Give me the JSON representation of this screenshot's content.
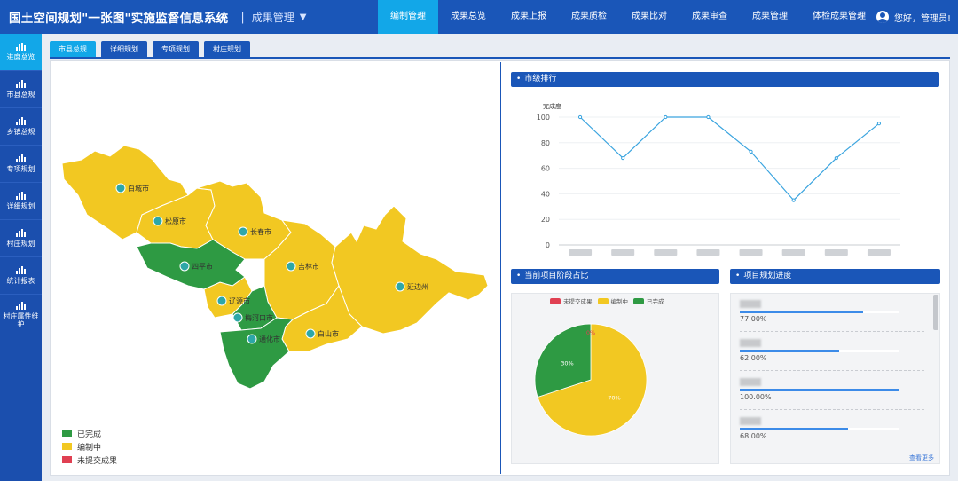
{
  "header": {
    "title": "国土空间规划\"一张图\"实施监督信息系统",
    "module_sep": "|",
    "module": "成果管理",
    "nav": [
      "编制管理",
      "成果总览",
      "成果上报",
      "成果质检",
      "成果比对",
      "成果审查",
      "成果管理",
      "体检成果管理"
    ],
    "active_nav": 0,
    "user": "您好，管理员!"
  },
  "sidebar": {
    "items": [
      "进度总览",
      "市县总规",
      "乡镇总规",
      "专项规划",
      "详细规划",
      "村庄规划",
      "统计报表",
      "村庄属性维护"
    ],
    "active": 0
  },
  "tabs": [
    "市县总规",
    "详细规划",
    "专项规划",
    "村庄规划"
  ],
  "map": {
    "cities": [
      "白城市",
      "松原市",
      "长春市",
      "四平市",
      "吉林市",
      "辽源市",
      "梅河口市",
      "通化市",
      "白山市",
      "延边州"
    ],
    "legend": [
      {
        "label": "已完成",
        "color": "#2e9a43"
      },
      {
        "label": "编制中",
        "color": "#f2c822"
      },
      {
        "label": "未提交成果",
        "color": "#e04052"
      }
    ]
  },
  "ranking": {
    "title": "市级排行",
    "ylabel": "完成度",
    "chart_data": {
      "type": "line",
      "title": "",
      "ylabel": "完成度",
      "ylim": [
        0,
        100
      ],
      "yticks": [
        0,
        20,
        40,
        60,
        80,
        100
      ],
      "series": [
        {
          "values": [
            100,
            68,
            100,
            100,
            73,
            35,
            68,
            95
          ]
        }
      ],
      "line_color": "#3aa4df"
    }
  },
  "stage": {
    "title": "当前项目阶段占比",
    "legend": [
      {
        "label": "未提交成果",
        "color": "#e04052"
      },
      {
        "label": "编制中",
        "color": "#f2c822"
      },
      {
        "label": "已完成",
        "color": "#2e9a43"
      }
    ],
    "chart_data": {
      "type": "pie",
      "categories": [
        "未提交成果",
        "编制中",
        "已完成"
      ],
      "values": [
        0,
        70,
        30
      ],
      "labels": [
        "0%",
        "70%",
        "30%"
      ],
      "colors": [
        "#e04052",
        "#f2c822",
        "#2e9a43"
      ]
    }
  },
  "progress": {
    "title": "项目规划进度",
    "items": [
      {
        "value": 0.77,
        "pct": "77.00%"
      },
      {
        "value": 0.62,
        "pct": "62.00%"
      },
      {
        "value": 1.0,
        "pct": "100.00%"
      },
      {
        "value": 0.68,
        "pct": "68.00%"
      }
    ],
    "more": "查看更多"
  }
}
